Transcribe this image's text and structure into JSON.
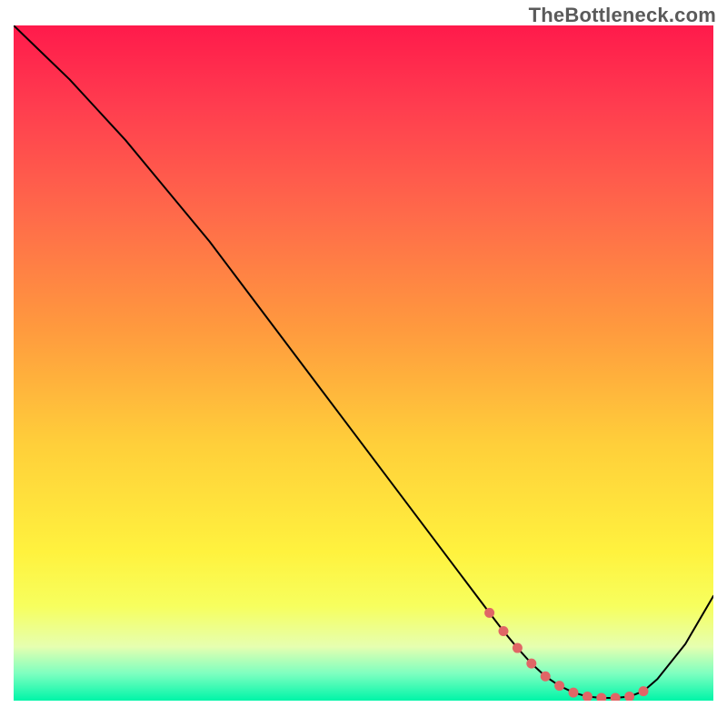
{
  "header": {
    "watermark": "TheBottleneck.com"
  },
  "colors": {
    "curve_stroke": "#000000",
    "dot_fill": "#e06666",
    "gradient_top": "#ff1a4b",
    "gradient_mid": "#ffcf3a",
    "gradient_bottom": "#00f5a8"
  },
  "chart_data": {
    "type": "line",
    "title": "",
    "xlabel": "",
    "ylabel": "",
    "xlim": [
      0,
      100
    ],
    "ylim": [
      0,
      100
    ],
    "grid": false,
    "legend": false,
    "series": [
      {
        "name": "bottleneck_curve",
        "x": [
          0,
          4,
          8,
          12,
          16,
          20,
          24,
          28,
          32,
          36,
          40,
          44,
          48,
          52,
          56,
          60,
          64,
          68,
          70,
          72,
          74,
          76,
          78,
          80,
          82,
          84,
          86,
          88,
          90,
          92,
          96,
          100
        ],
        "y": [
          100,
          96,
          92,
          87.5,
          83,
          78,
          73,
          68,
          62.5,
          57,
          51.5,
          46,
          40.5,
          35,
          29.5,
          24,
          18.5,
          13,
          10.3,
          7.8,
          5.5,
          3.6,
          2.2,
          1.2,
          0.6,
          0.4,
          0.4,
          0.6,
          1.4,
          3.2,
          8.4,
          15.5
        ]
      }
    ],
    "valley_markers": {
      "name": "valley_dots",
      "x": [
        68,
        70,
        72,
        74,
        76,
        78,
        80,
        82,
        84,
        86,
        88,
        90
      ],
      "y": [
        13,
        10.3,
        7.8,
        5.5,
        3.6,
        2.2,
        1.2,
        0.6,
        0.4,
        0.4,
        0.6,
        1.4
      ]
    }
  }
}
